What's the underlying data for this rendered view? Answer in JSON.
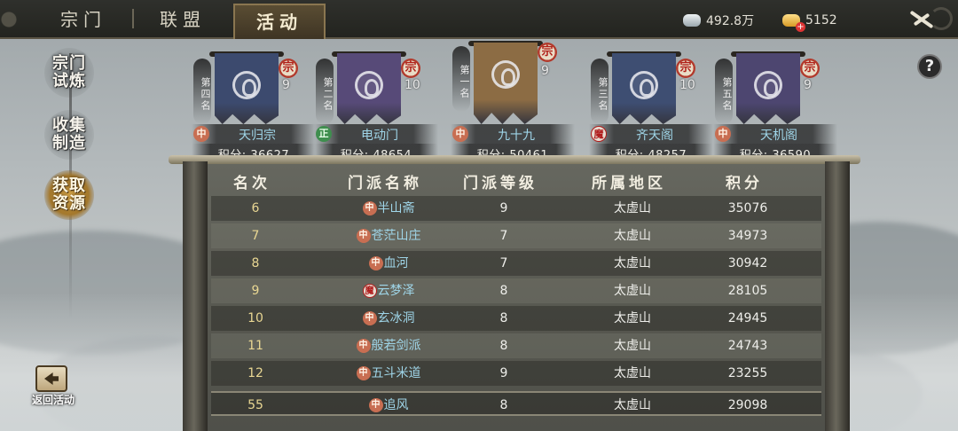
{
  "tabs": [
    "宗门",
    "联盟",
    "活动"
  ],
  "active_tab": "活动",
  "currency": {
    "silver": "492.8万",
    "gold": "5152"
  },
  "side_menu": [
    {
      "label": "宗门试炼",
      "active": false
    },
    {
      "label": "收集制造",
      "active": false
    },
    {
      "label": "获取资源",
      "active": true
    }
  ],
  "help_label": "?",
  "back_label": "返回活动",
  "top_five": [
    {
      "rank_label": "第四名",
      "name": "天归宗",
      "faction": "中",
      "level": "9",
      "score_label": "积分:",
      "score": "36627",
      "badge": "宗",
      "color": "#3c4a6e"
    },
    {
      "rank_label": "第二名",
      "name": "电动门",
      "faction": "正",
      "level": "10",
      "score_label": "积分:",
      "score": "48654",
      "badge": "宗",
      "color": "#574a78"
    },
    {
      "rank_label": "第一名",
      "name": "九十九",
      "faction": "中",
      "level": "9",
      "score_label": "积分:",
      "score": "50461",
      "badge": "宗",
      "color": "#8c6c44"
    },
    {
      "rank_label": "第三名",
      "name": "齐天阁",
      "faction": "魔",
      "level": "10",
      "score_label": "积分:",
      "score": "48257",
      "badge": "宗",
      "color": "#3e4e72"
    },
    {
      "rank_label": "第五名",
      "name": "天机阁",
      "faction": "中",
      "level": "9",
      "score_label": "积分:",
      "score": "36590",
      "badge": "宗",
      "color": "#4d4670"
    }
  ],
  "table": {
    "headers": [
      "名次",
      "门派名称",
      "门派等级",
      "所属地区",
      "积分"
    ],
    "rows": [
      {
        "rank": "6",
        "faction": "中",
        "name": "半山斋",
        "level": "9",
        "region": "太虚山",
        "score": "35076"
      },
      {
        "rank": "7",
        "faction": "中",
        "name": "苍茫山庄",
        "level": "7",
        "region": "太虚山",
        "score": "34973"
      },
      {
        "rank": "8",
        "faction": "中",
        "name": "血河",
        "level": "7",
        "region": "太虚山",
        "score": "30942"
      },
      {
        "rank": "9",
        "faction": "魔",
        "name": "云梦泽",
        "level": "8",
        "region": "太虚山",
        "score": "28105"
      },
      {
        "rank": "10",
        "faction": "中",
        "name": "玄冰洞",
        "level": "8",
        "region": "太虚山",
        "score": "24945"
      },
      {
        "rank": "11",
        "faction": "中",
        "name": "般若剑派",
        "level": "8",
        "region": "太虚山",
        "score": "24743"
      },
      {
        "rank": "12",
        "faction": "中",
        "name": "五斗米道",
        "level": "9",
        "region": "太虚山",
        "score": "23255"
      }
    ],
    "self_row": {
      "rank": "55",
      "faction": "中",
      "name": "追风",
      "level": "8",
      "region": "太虚山",
      "score": "29098"
    }
  }
}
